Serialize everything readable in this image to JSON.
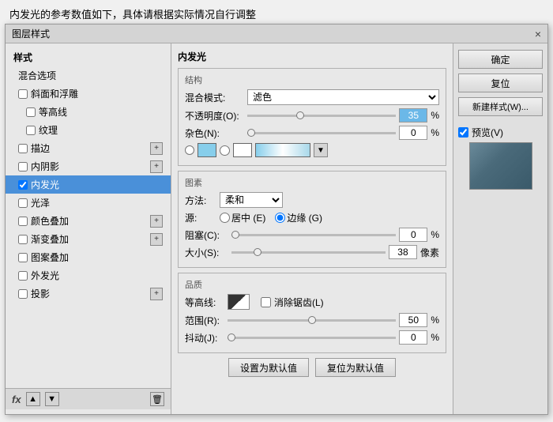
{
  "header": {
    "title": "内发光的参考数值如下，具体请根据实际情况自行调整"
  },
  "dialog": {
    "title": "图层样式",
    "close_btn": "×",
    "left_panel": {
      "section_title": "样式",
      "items": [
        {
          "id": "hunhe",
          "label": "混合选项",
          "has_plus": false,
          "checked": false,
          "selected": false
        },
        {
          "id": "xiehe",
          "label": "斜面和浮雕",
          "has_plus": false,
          "checked": false,
          "selected": false
        },
        {
          "id": "denggaoxian",
          "label": "等高线",
          "has_plus": false,
          "checked": false,
          "selected": false,
          "indent": true
        },
        {
          "id": "wenli",
          "label": "纹理",
          "has_plus": false,
          "checked": false,
          "selected": false,
          "indent": true
        },
        {
          "id": "miaobian",
          "label": "描边",
          "has_plus": true,
          "checked": false,
          "selected": false
        },
        {
          "id": "neiyinying",
          "label": "内阴影",
          "has_plus": true,
          "checked": false,
          "selected": false
        },
        {
          "id": "neifaguang",
          "label": "内发光",
          "has_plus": false,
          "checked": true,
          "selected": true
        },
        {
          "id": "guangze",
          "label": "光泽",
          "has_plus": false,
          "checked": false,
          "selected": false
        },
        {
          "id": "yansedichenga",
          "label": "颜色叠加",
          "has_plus": true,
          "checked": false,
          "selected": false
        },
        {
          "id": "jiandiedichenga",
          "label": "渐变叠加",
          "has_plus": true,
          "checked": false,
          "selected": false
        },
        {
          "id": "tubandiechenga",
          "label": "图案叠加",
          "has_plus": false,
          "checked": false,
          "selected": false
        },
        {
          "id": "waifaguang",
          "label": "外发光",
          "has_plus": false,
          "checked": false,
          "selected": false
        },
        {
          "id": "touying",
          "label": "投影",
          "has_plus": true,
          "checked": false,
          "selected": false
        }
      ],
      "footer": {
        "fx_label": "fx",
        "up_arrow": "▲",
        "down_arrow": "▼",
        "trash_icon": "🗑"
      }
    },
    "right_panel": {
      "confirm_btn": "确定",
      "reset_btn": "复位",
      "new_style_btn": "新建样式(W)...",
      "preview_label": "预览(V)",
      "preview_checked": true
    },
    "main_content": {
      "section_title": "内发光",
      "structure": {
        "title": "结构",
        "blend_mode_label": "混合模式:",
        "blend_mode_value": "滤色",
        "opacity_label": "不透明度(O):",
        "opacity_value": "35",
        "noise_label": "杂色(N):",
        "noise_value": "0"
      },
      "elements": {
        "title": "图素",
        "method_label": "方法:",
        "method_value": "柔和",
        "source_label": "源:",
        "source_center": "居中 (E)",
        "source_edge": "边缘 (G)",
        "source_edge_selected": true,
        "choke_label": "阻塞(C):",
        "choke_value": "0",
        "size_label": "大小(S):",
        "size_value": "38",
        "size_unit": "像素"
      },
      "quality": {
        "title": "品质",
        "contour_label": "等高线:",
        "smooth_label": "消除锯齿(L)",
        "smooth_checked": false,
        "range_label": "范围(R):",
        "range_value": "50",
        "jitter_label": "抖动(J):",
        "jitter_value": "0"
      },
      "bottom_btns": {
        "set_default": "设置为默认值",
        "reset_default": "复位为默认值"
      }
    }
  }
}
